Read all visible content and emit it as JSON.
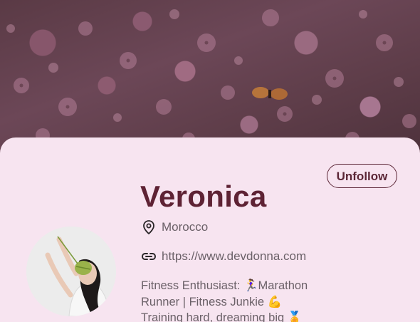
{
  "profile": {
    "name": "Veronica",
    "location": "Morocco",
    "website": "https://www.devdonna.com",
    "bio_lines": [
      "Fitness Enthusiast: 🏃‍♀️Marathon",
      "Runner | Fitness Junkie 💪",
      "Training hard, dreaming big 🏅"
    ]
  },
  "actions": {
    "unfollow_label": "Unfollow"
  },
  "icons": {
    "location": "map-pin-icon",
    "website": "link-icon"
  },
  "colors": {
    "card_background": "#f7e4f0",
    "name_text": "#5e2234",
    "accent": "#5b2636",
    "body_text": "#6b6168"
  }
}
